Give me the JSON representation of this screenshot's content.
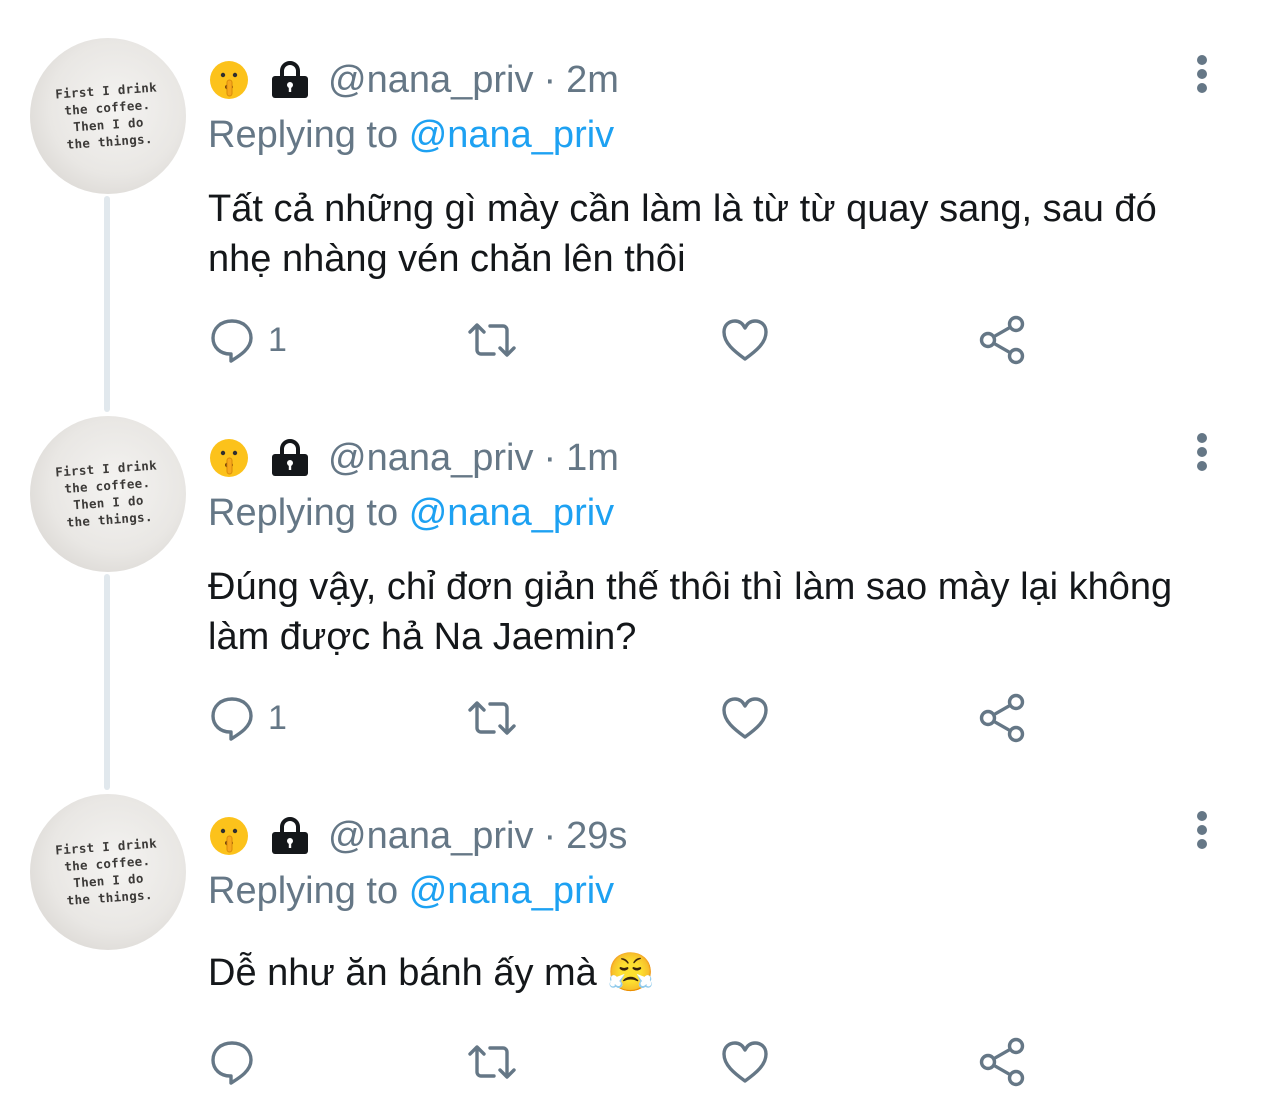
{
  "tweets": [
    {
      "author": {
        "avatar_text": "First I drink\nthe coffee.\nThen I do\nthe things.",
        "name_emoji": "🤫",
        "handle": "@nana_priv",
        "separator": "·",
        "time": "2m"
      },
      "replying_prefix": "Replying to",
      "replying_handle": "@nana_priv",
      "text": "Tất cả những gì mày cần làm là từ từ quay sang, sau đó nhẹ nhàng vén chăn lên thôi",
      "reply_count": "1"
    },
    {
      "author": {
        "avatar_text": "First I drink\nthe coffee.\nThen I do\nthe things.",
        "name_emoji": "🤫",
        "handle": "@nana_priv",
        "separator": "·",
        "time": "1m"
      },
      "replying_prefix": "Replying to",
      "replying_handle": "@nana_priv",
      "text": "Đúng vậy, chỉ đơn giản thế thôi thì làm sao mày lại không làm được hả Na Jaemin?",
      "reply_count": "1"
    },
    {
      "author": {
        "avatar_text": "First I drink\nthe coffee.\nThen I do\nthe things.",
        "name_emoji": "🤫",
        "handle": "@nana_priv",
        "separator": "·",
        "time": "29s"
      },
      "replying_prefix": "Replying to",
      "replying_handle": "@nana_priv",
      "text": "Dễ như ăn bánh ấy mà 😤",
      "reply_count": ""
    }
  ],
  "icons": {
    "reply": "speech-bubble-icon",
    "retweet": "retweet-arrows-icon",
    "like": "heart-icon",
    "share": "share-nodes-icon",
    "more": "vertical-ellipsis-icon",
    "lock": "lock-icon"
  },
  "colors": {
    "text_primary": "#14171a",
    "text_secondary": "#657786",
    "link": "#1da1f2",
    "thread_line": "#e1e8ed"
  }
}
